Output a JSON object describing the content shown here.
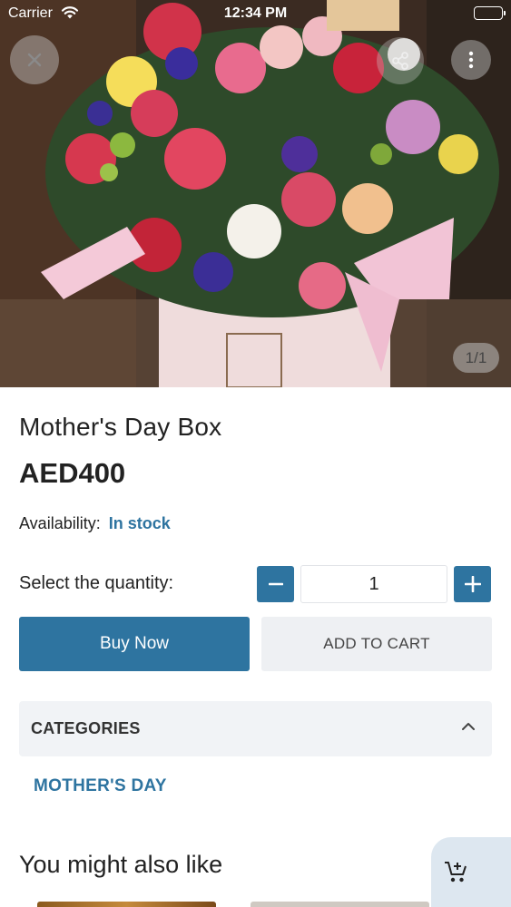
{
  "status_bar": {
    "carrier": "Carrier",
    "time": "12:34 PM",
    "wifi_icon": "wifi-icon",
    "battery_icon": "battery-icon"
  },
  "gallery": {
    "counter": "1/1",
    "close_icon": "close-icon",
    "share_icon": "share-icon",
    "more_icon": "more-vertical-icon"
  },
  "product": {
    "title": "Mother's Day Box",
    "price": "AED400",
    "availability_label": "Availability:",
    "availability_value": "In stock"
  },
  "quantity": {
    "label": "Select the quantity:",
    "value": "1",
    "minus_icon": "minus-icon",
    "plus_icon": "plus-icon"
  },
  "actions": {
    "buy_now": "Buy Now",
    "add_to_cart": "ADD TO CART"
  },
  "categories": {
    "header": "CATEGORIES",
    "expanded": true,
    "items": [
      "MOTHER'S DAY"
    ]
  },
  "recommendations": {
    "title": "You might also like"
  },
  "colors": {
    "primary": "#2e74a0",
    "secondary_button_bg": "#eef0f3",
    "section_bg": "#f1f3f6",
    "cart_fab_bg": "#dde7f0"
  }
}
